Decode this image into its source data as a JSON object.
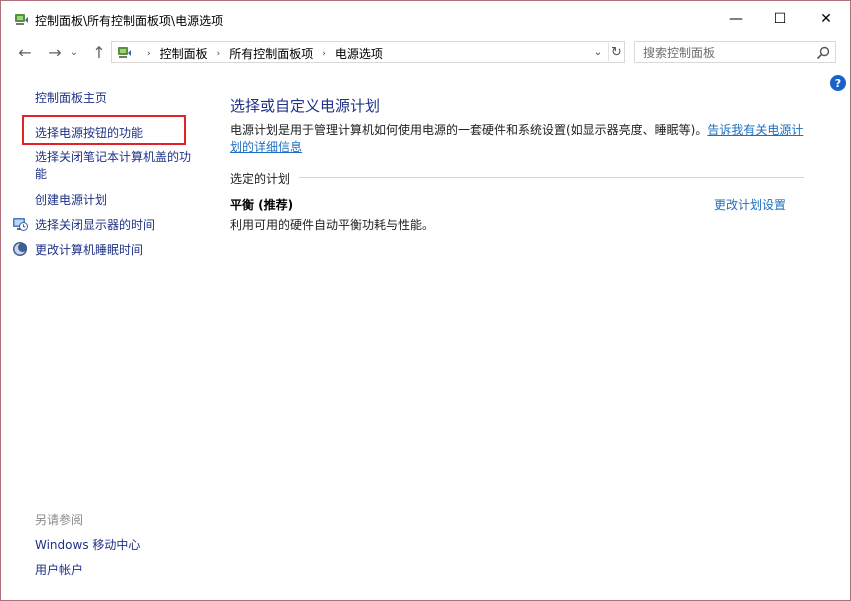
{
  "window": {
    "title": "控制面板\\所有控制面板项\\电源选项",
    "controls": {
      "minimize": "—",
      "maximize": "☐",
      "close": "✕"
    }
  },
  "nav": {
    "back": "←",
    "forward": "→",
    "recent": "⌄",
    "up": "↑",
    "crumbs": [
      "控制面板",
      "所有控制面板项",
      "电源选项"
    ],
    "crumb_sep": "›",
    "address_dropdown": "⌄",
    "refresh": "↻",
    "search_placeholder": "搜索控制面板"
  },
  "sidebar": {
    "home": "控制面板主页",
    "items": [
      {
        "label": "选择电源按钮的功能",
        "highlighted": true
      },
      {
        "label": "选择关闭笔记本计算机盖的功能"
      },
      {
        "label": "创建电源计划"
      },
      {
        "label": "选择关闭显示器的时间",
        "icon": "display-clock-icon"
      },
      {
        "label": "更改计算机睡眠时间",
        "icon": "moon-icon"
      }
    ],
    "see_also": {
      "heading": "另请参阅",
      "links": [
        "Windows 移动中心",
        "用户帐户"
      ]
    }
  },
  "main": {
    "title": "选择或自定义电源计划",
    "description": "电源计划是用于管理计算机如何使用电源的一套硬件和系统设置(如显示器亮度、睡眠等)。",
    "description_link": "告诉我有关电源计划的详细信息",
    "section_label": "选定的计划",
    "plan": {
      "name": "平衡 (推荐)",
      "description": "利用可用的硬件自动平衡功耗与性能。",
      "change_link": "更改计划设置"
    }
  },
  "help": "?",
  "colors": {
    "link": "#1e3287",
    "hyperlink": "#1e6fc0",
    "highlight_border": "#e3212a",
    "window_border": "#b0707a"
  }
}
